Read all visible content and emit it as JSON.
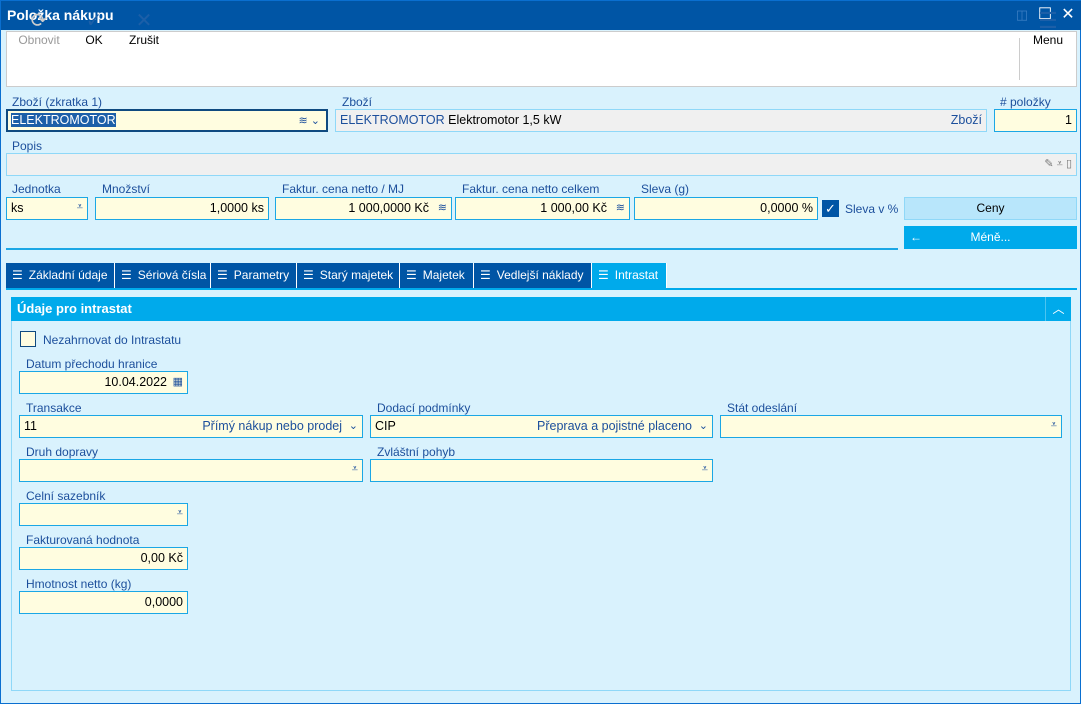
{
  "window": {
    "title": "Položka nákupu"
  },
  "toolbar": {
    "refresh": "Obnovit",
    "ok": "OK",
    "cancel": "Zrušit",
    "menu": "Menu"
  },
  "header": {
    "goods_code_label": "Zboží (zkratka 1)",
    "goods_code_value": "ELEKTROMOTOR",
    "goods_label": "Zboží",
    "goods_code": "ELEKTROMOTOR",
    "goods_name": "Elektromotor 1,5 kW",
    "goods_type": "Zboží",
    "item_no_label": "# položky",
    "item_no_value": "1",
    "description_label": "Popis"
  },
  "pricing": {
    "unit_label": "Jednotka",
    "unit_value": "ks",
    "qty_label": "Množství",
    "qty_value": "1,0000 ks",
    "unit_price_label": "Faktur. cena netto / MJ",
    "unit_price_value": "1 000,0000 Kč",
    "total_label": "Faktur. cena netto celkem",
    "total_value": "1 000,00 Kč",
    "discount_label": "Sleva (g)",
    "discount_value": "0,0000 %",
    "discount_pct_label": "Sleva v %",
    "discount_pct_checked": true,
    "prices_button": "Ceny",
    "less_button": "Méně..."
  },
  "tabs": [
    {
      "label": "Základní údaje"
    },
    {
      "label": "Sériová čísla"
    },
    {
      "label": "Parametry"
    },
    {
      "label": "Starý majetek"
    },
    {
      "label": "Majetek"
    },
    {
      "label": "Vedlejší náklady"
    },
    {
      "label": "Intrastat",
      "active": true
    }
  ],
  "intrastat": {
    "title": "Údaje pro intrastat",
    "exclude_label": "Nezahrnovat do Intrastatu",
    "exclude_checked": false,
    "date_label": "Datum přechodu hranice",
    "date_value": "10.04.2022",
    "transaction_label": "Transakce",
    "transaction_code": "11",
    "transaction_text": "Přímý nákup nebo prodej",
    "delivery_label": "Dodací podmínky",
    "delivery_code": "CIP",
    "delivery_text": "Přeprava a pojistné placeno",
    "country_label": "Stát odeslání",
    "country_value": "",
    "transport_label": "Druh dopravy",
    "transport_value": "",
    "special_label": "Zvláštní pohyb",
    "special_value": "",
    "tariff_label": "Celní sazebník",
    "tariff_value": "",
    "invoiced_label": "Fakturovaná hodnota",
    "invoiced_value": "0,00 Kč",
    "weight_label": "Hmotnost netto (kg)",
    "weight_value": "0,0000"
  },
  "colors": {
    "titlebar": "#0055a5",
    "accent": "#00aaeb",
    "background": "#d9f2fd",
    "input": "#fffde0"
  }
}
